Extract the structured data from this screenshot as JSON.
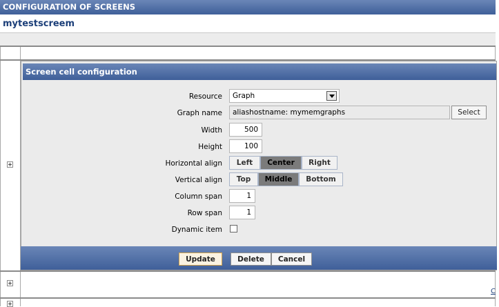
{
  "header": {
    "title": "CONFIGURATION OF SCREENS"
  },
  "screen": {
    "name": "mytestscreem"
  },
  "panel": {
    "title": "Screen cell configuration",
    "fields": {
      "resource": {
        "label": "Resource",
        "value": "Graph"
      },
      "graph_name": {
        "label": "Graph name",
        "value": "aliashostname: mymemgraphs",
        "select_label": "Select"
      },
      "width": {
        "label": "Width",
        "value": "500"
      },
      "height": {
        "label": "Height",
        "value": "100"
      },
      "horizontal_align": {
        "label": "Horizontal align",
        "options": [
          "Left",
          "Center",
          "Right"
        ],
        "selected": "Center"
      },
      "vertical_align": {
        "label": "Vertical align",
        "options": [
          "Top",
          "Middle",
          "Bottom"
        ],
        "selected": "Middle"
      },
      "column_span": {
        "label": "Column span",
        "value": "1"
      },
      "row_span": {
        "label": "Row span",
        "value": "1"
      },
      "dynamic_item": {
        "label": "Dynamic item",
        "checked": false
      }
    },
    "buttons": {
      "update": "Update",
      "delete": "Delete",
      "cancel": "Cancel"
    }
  },
  "grid": {
    "corner_fragment": "C"
  },
  "icons": {
    "expand": "plus-box-icon",
    "dropdown": "chevron-down-icon"
  }
}
